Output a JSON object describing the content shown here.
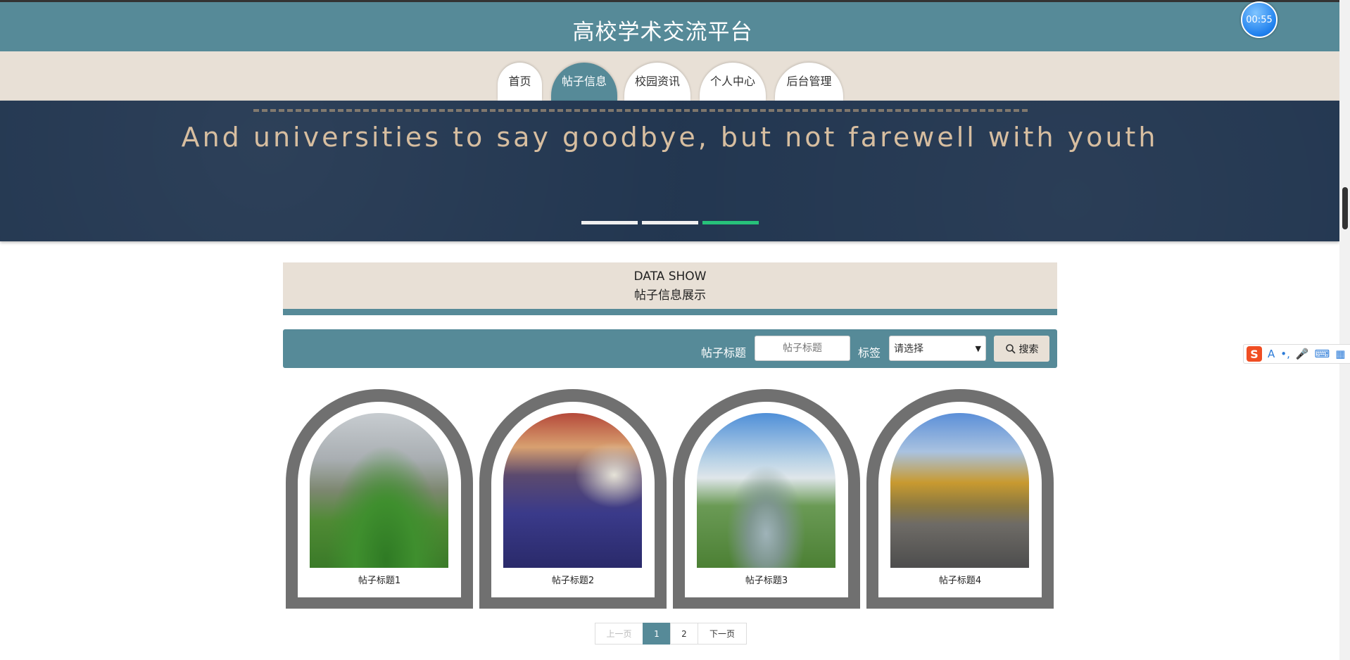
{
  "site_title": "高校学术交流平台",
  "timer": "00:55",
  "nav": [
    {
      "label": "首页",
      "active": false
    },
    {
      "label": "帖子信息",
      "active": true
    },
    {
      "label": "校园资讯",
      "active": false
    },
    {
      "label": "个人中心",
      "active": false
    },
    {
      "label": "后台管理",
      "active": false
    }
  ],
  "banner": {
    "text": "And universities to say goodbye, but not farewell with youth",
    "slide_count": 3,
    "active_slide": 3
  },
  "section": {
    "title_en": "DATA SHOW",
    "title_cn": "帖子信息展示"
  },
  "search": {
    "title_label": "帖子标题",
    "title_placeholder": "帖子标题",
    "tag_label": "标签",
    "tag_selected": "请选择",
    "button_label": "搜索"
  },
  "posts": [
    {
      "title": "帖子标题1"
    },
    {
      "title": "帖子标题2"
    },
    {
      "title": "帖子标题3"
    },
    {
      "title": "帖子标题4"
    }
  ],
  "pagination": {
    "prev": "上一页",
    "pages": [
      "1",
      "2"
    ],
    "current": "1",
    "next": "下一页"
  },
  "colors": {
    "primary": "#568a98",
    "beige": "#e8e0d6",
    "banner": "#223650",
    "active_dot": "#27c27a"
  }
}
